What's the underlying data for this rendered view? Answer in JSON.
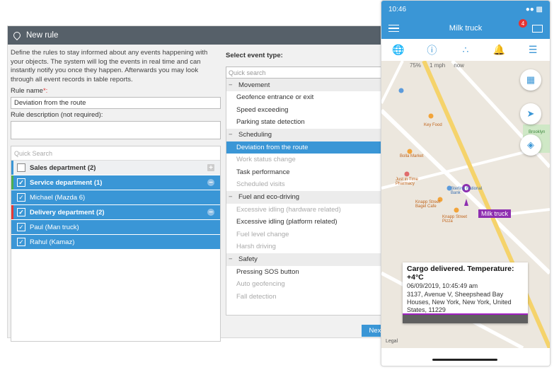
{
  "dialog": {
    "title": "New rule",
    "intro": "Define the rules to stay informed about any events happening with your objects. The system will log the events in real time and can instantly notify you once they happen. Afterwards you may look through all event records in table reports.",
    "rule_name_label": "Rule name",
    "rule_name_required": "*:",
    "rule_name_value": "Deviation from the route",
    "rule_desc_label": "Rule description (not required):",
    "quick_search": "Quick Search",
    "groups": [
      {
        "label": "Sales department (2)",
        "checked": false,
        "stripe": "#3a96d6",
        "bold": true,
        "action": "+"
      },
      {
        "label": "Service department (1)",
        "checked": true,
        "stripe": "#4caf50",
        "bold": true,
        "action": "−"
      },
      {
        "label": "Michael (Mazda 6)",
        "checked": true,
        "stripe": "",
        "bold": false,
        "action": ""
      },
      {
        "label": "Delivery department (2)",
        "checked": true,
        "stripe": "#e53935",
        "bold": true,
        "action": "−"
      },
      {
        "label": "Paul (Man truck)",
        "checked": true,
        "stripe": "",
        "bold": false,
        "action": ""
      },
      {
        "label": "Rahul (Kamaz)",
        "checked": true,
        "stripe": "",
        "bold": false,
        "action": ""
      }
    ],
    "event_type_title": "Select event type:",
    "event_search": "Quick search",
    "categories": [
      {
        "name": "Movement",
        "events": [
          {
            "label": "Geofence entrance or exit",
            "state": "normal"
          },
          {
            "label": "Speed exceeding",
            "state": "normal"
          },
          {
            "label": "Parking state detection",
            "state": "normal"
          }
        ]
      },
      {
        "name": "Scheduling",
        "events": [
          {
            "label": "Deviation from the route",
            "state": "selected"
          },
          {
            "label": "Work status change",
            "state": "disabled"
          },
          {
            "label": "Task performance",
            "state": "normal"
          },
          {
            "label": "Scheduled visits",
            "state": "disabled"
          }
        ]
      },
      {
        "name": "Fuel and eco-driving",
        "events": [
          {
            "label": "Excessive idling (hardware related)",
            "state": "disabled"
          },
          {
            "label": "Excessive idling (platform related)",
            "state": "normal"
          },
          {
            "label": "Fuel level change",
            "state": "disabled"
          },
          {
            "label": "Harsh driving",
            "state": "disabled"
          }
        ]
      },
      {
        "name": "Safety",
        "events": [
          {
            "label": "Pressing SOS button",
            "state": "normal"
          },
          {
            "label": "Auto geofencing",
            "state": "disabled"
          },
          {
            "label": "Fall detection",
            "state": "disabled"
          }
        ]
      }
    ],
    "next_label": "Nex"
  },
  "phone": {
    "time": "10:46",
    "title": "Milk truck",
    "badge": "4",
    "map_stats": [
      "75%",
      "1 mph",
      "now"
    ],
    "pois": [
      "Key Food",
      "Bolla Market",
      "Just in Time Pharmacy",
      "Sterling National Bank",
      "Knapp Street Bagel Cafe",
      "Knapp Street Pizza",
      "Brooklyn"
    ],
    "truck_label": "Milk truck",
    "card": {
      "title": "Cargo delivered. Temperature: +4°C",
      "time": "06/09/2019, 10:45:49 am",
      "address": "3137, Avenue V, Sheepshead Bay Houses, New York, New York, United States, 11229"
    },
    "legal": "Legal"
  },
  "colors": {
    "accent": "#3a96d6",
    "titlebar": "#566069",
    "truck": "#8e2fb0"
  }
}
